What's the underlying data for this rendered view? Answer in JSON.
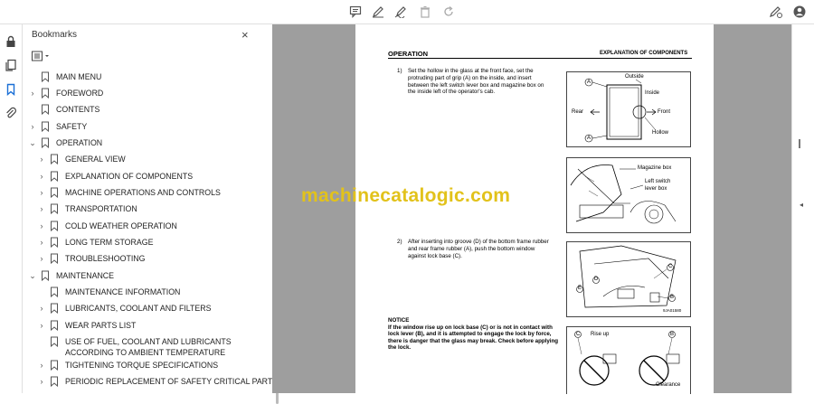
{
  "toolbar": {
    "icons": [
      "comment-icon",
      "pen-icon",
      "sign-icon",
      "trash-icon",
      "rotate-icon",
      "share-key-icon",
      "account-icon"
    ]
  },
  "rail": {
    "icons": [
      "lock-icon",
      "pages-icon",
      "bookmark-icon",
      "attachment-icon"
    ]
  },
  "panel": {
    "title": "Bookmarks",
    "close": "×"
  },
  "bookmarks": [
    {
      "label": "MAIN MENU",
      "chevron": ""
    },
    {
      "label": "FOREWORD",
      "chevron": "›"
    },
    {
      "label": "CONTENTS",
      "chevron": ""
    },
    {
      "label": "SAFETY",
      "chevron": "›"
    },
    {
      "label": "OPERATION",
      "chevron": "⌄"
    },
    {
      "label": "GENERAL VIEW",
      "chevron": "›"
    },
    {
      "label": "EXPLANATION OF COMPONENTS",
      "chevron": "›"
    },
    {
      "label": "MACHINE OPERATIONS AND CONTROLS",
      "chevron": "›"
    },
    {
      "label": "TRANSPORTATION",
      "chevron": "›"
    },
    {
      "label": "COLD WEATHER OPERATION",
      "chevron": "›"
    },
    {
      "label": "LONG TERM STORAGE",
      "chevron": "›"
    },
    {
      "label": "TROUBLESHOOTING",
      "chevron": "›"
    },
    {
      "label": "MAINTENANCE",
      "chevron": "⌄"
    },
    {
      "label": "MAINTENANCE INFORMATION",
      "chevron": ""
    },
    {
      "label": "LUBRICANTS, COOLANT AND FILTERS",
      "chevron": "›"
    },
    {
      "label": "WEAR PARTS LIST",
      "chevron": "›"
    },
    {
      "label": "USE OF FUEL, COOLANT AND LUBRICANTS",
      "label2": "ACCORDING TO AMBIENT TEMPERATURE",
      "chevron": ""
    },
    {
      "label": "TIGHTENING TORQUE SPECIFICATIONS",
      "chevron": "›"
    },
    {
      "label": "PERIODIC REPLACEMENT OF SAFETY CRITICAL PARTS",
      "chevron": "›"
    }
  ],
  "document": {
    "header_left": "OPERATION",
    "header_right": "EXPLANATION OF COMPONENTS",
    "step1_num": "1)",
    "step1_text": "Set the hollow in the glass at the front face, set the protruding part of grip (A) on the inside, and insert between the left switch lever box and magazine box on the inside left of the operator's cab.",
    "step2_num": "2)",
    "step2_text": "After inserting into groove (D) of the bottom frame rubber and rear frame rubber (A), push the bottom window against lock base (C).",
    "notice_title": "NOTICE",
    "notice_text": "If the window rise up on lock base (C) or is not in contact with lock lever (B), and it is attempted to engage the lock by force, there is danger that the glass may break. Check before applying the lock.",
    "fig1": {
      "outside": "Outside",
      "inside": "Inside",
      "rear": "Rear",
      "front": "Front",
      "hollow": "Hollow",
      "a": "A"
    },
    "fig2": {
      "magazine": "Magazine box",
      "left_switch_1": "Left switch",
      "left_switch_2": "lever box"
    },
    "fig3": {
      "code": "9JA01580",
      "c": "C",
      "b": "B",
      "d": "D",
      "e": "E"
    },
    "fig4": {
      "rise": "Rise up",
      "clearance": "Clearance",
      "c": "C",
      "b": "B"
    }
  },
  "watermark": "machinecatalogic.com"
}
